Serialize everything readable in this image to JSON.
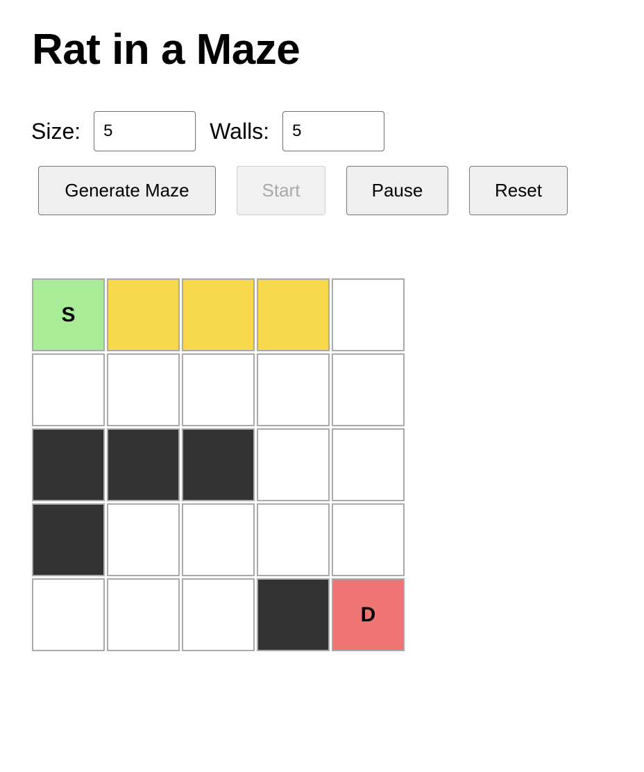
{
  "title": "Rat in a Maze",
  "controls": {
    "size_label": "Size:",
    "size_value": "5",
    "walls_label": "Walls:",
    "walls_value": "5"
  },
  "buttons": {
    "generate": "Generate Maze",
    "start": "Start",
    "start_disabled": true,
    "pause": "Pause",
    "reset": "Reset"
  },
  "colors": {
    "start": "#a8ec98",
    "path": "#f8d84c",
    "wall": "#333333",
    "open": "#ffffff",
    "destination": "#ef7474"
  },
  "maze": {
    "size": 5,
    "cells": [
      [
        "start",
        "path",
        "path",
        "path",
        "open"
      ],
      [
        "open",
        "open",
        "open",
        "open",
        "open"
      ],
      [
        "wall",
        "wall",
        "wall",
        "open",
        "open"
      ],
      [
        "wall",
        "open",
        "open",
        "open",
        "open"
      ],
      [
        "open",
        "open",
        "open",
        "wall",
        "destination"
      ]
    ],
    "labels": {
      "start": "S",
      "destination": "D"
    }
  }
}
